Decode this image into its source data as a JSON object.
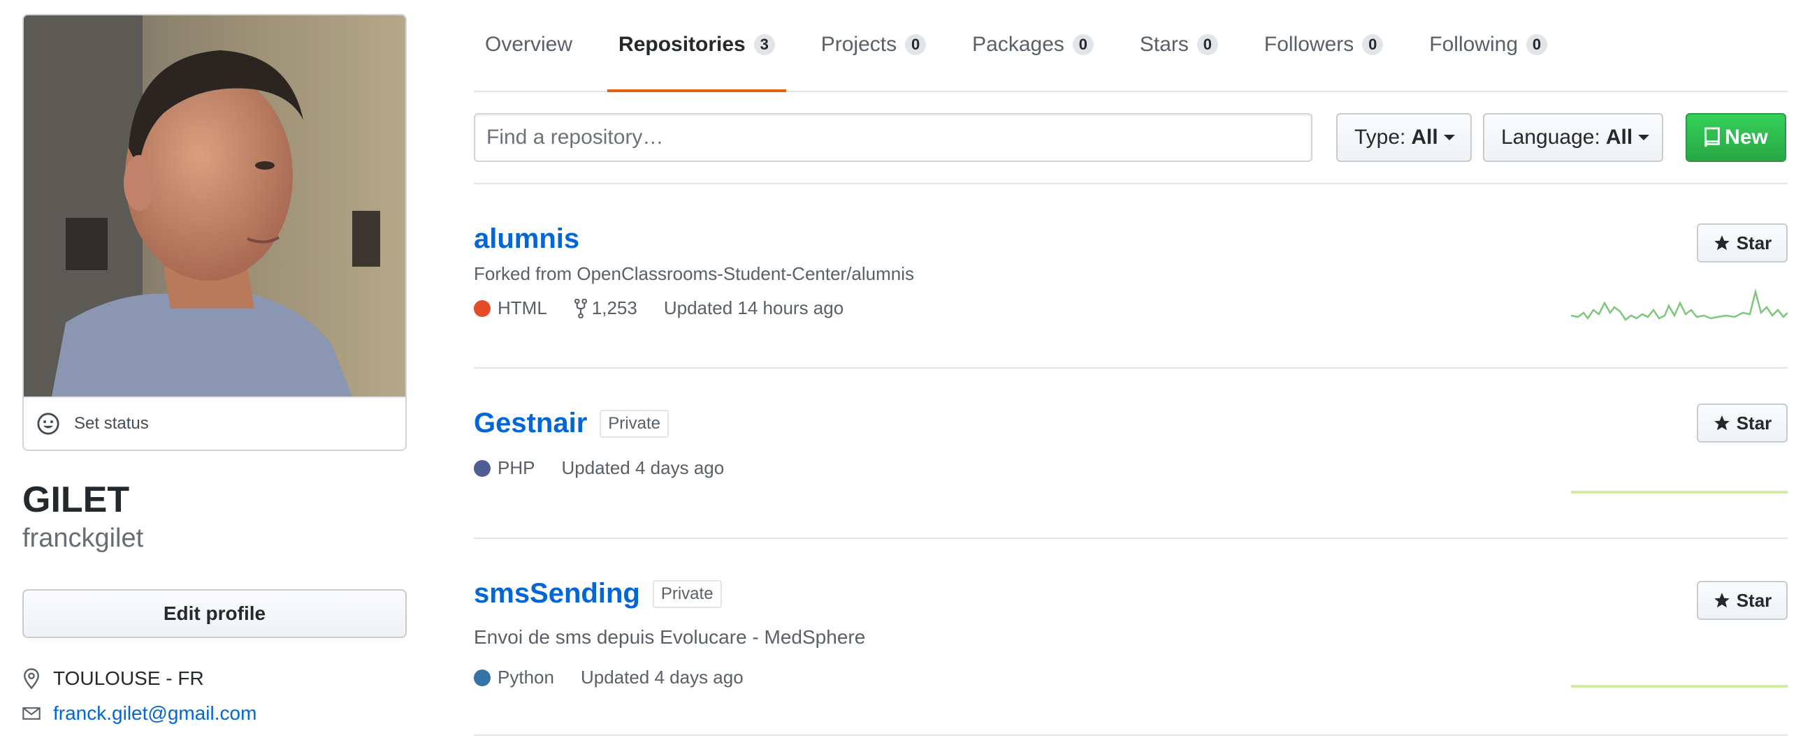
{
  "profile": {
    "set_status": "Set status",
    "full_name": "GILET",
    "username": "franckgilet",
    "edit_profile": "Edit profile",
    "location": "TOULOUSE - FR",
    "email": "franck.gilet@gmail.com"
  },
  "tabs": [
    {
      "label": "Overview",
      "count": null
    },
    {
      "label": "Repositories",
      "count": "3",
      "selected": true
    },
    {
      "label": "Projects",
      "count": "0"
    },
    {
      "label": "Packages",
      "count": "0"
    },
    {
      "label": "Stars",
      "count": "0"
    },
    {
      "label": "Followers",
      "count": "0"
    },
    {
      "label": "Following",
      "count": "0"
    }
  ],
  "filters": {
    "search_placeholder": "Find a repository…",
    "type_label": "Type:",
    "type_value": "All",
    "language_label": "Language:",
    "language_value": "All",
    "new_label": "New"
  },
  "repos": [
    {
      "name": "alumnis",
      "badge": null,
      "description": "Forked from OpenClassrooms-Student-Center/alumnis",
      "language": "HTML",
      "language_color": "#e34c26",
      "forks": "1,253",
      "updated": "Updated 14 hours ago",
      "star_label": "Star"
    },
    {
      "name": "Gestnair",
      "badge": "Private",
      "description": null,
      "language": "PHP",
      "language_color": "#4F5D95",
      "forks": null,
      "updated": "Updated 4 days ago",
      "star_label": "Star"
    },
    {
      "name": "smsSending",
      "badge": "Private",
      "description": "Envoi de sms depuis Evolucare - MedSphere",
      "language": "Python",
      "language_color": "#3572A5",
      "forks": null,
      "updated": "Updated 4 days ago",
      "star_label": "Star"
    }
  ],
  "colors": {
    "accent_tab": "#e36209",
    "link": "#0366d6",
    "new_button": "#28a745",
    "sparkline": "#7cc77a"
  }
}
